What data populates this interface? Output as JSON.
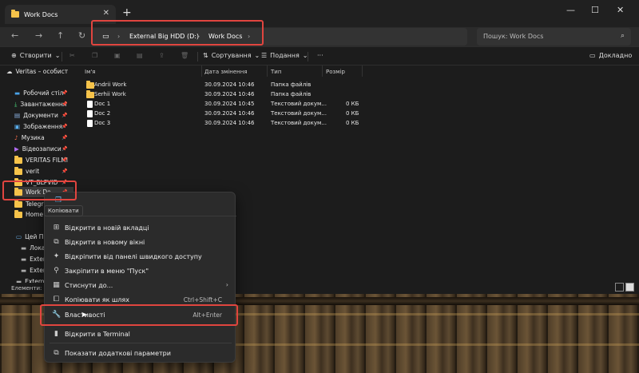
{
  "window": {
    "tab_title": "Work Docs",
    "new_tab": "+",
    "controls": [
      "—",
      "☐",
      "✕"
    ]
  },
  "nav": {
    "breadcrumbs": [
      "External Big HDD (D:)",
      "Work Docs"
    ],
    "search_placeholder": "Пошук: Work Docs"
  },
  "toolbar": {
    "create_label": "Створити",
    "sort_label": "Сортування",
    "view_label": "Подання",
    "more_label": "···",
    "details_label": "Докладно"
  },
  "sidebar": {
    "items": [
      {
        "label": "Veritas – особист",
        "icon": "cloud-icon",
        "pinned": false
      },
      {
        "label": "Робочий стіл",
        "icon": "desktop-icon",
        "pinned": true
      },
      {
        "label": "Завантаження",
        "icon": "download-icon",
        "pinned": true
      },
      {
        "label": "Документи",
        "icon": "documents-icon",
        "pinned": true
      },
      {
        "label": "Зображення",
        "icon": "pictures-icon",
        "pinned": true
      },
      {
        "label": "Музика",
        "icon": "music-icon",
        "pinned": true
      },
      {
        "label": "Відеозаписи",
        "icon": "videos-icon",
        "pinned": true
      },
      {
        "label": "VERITAS FILMI",
        "icon": "folder-icon",
        "pinned": true
      },
      {
        "label": "verit",
        "icon": "folder-icon",
        "pinned": true
      },
      {
        "label": "VT_BLPVID",
        "icon": "folder-icon",
        "pinned": true
      },
      {
        "label": "Work Do",
        "icon": "folder-icon",
        "pinned": true
      },
      {
        "label": "Telegra",
        "icon": "folder-icon",
        "pinned": false
      },
      {
        "label": "Home A",
        "icon": "folder-icon",
        "pinned": false
      },
      {
        "label": "Цей ПК",
        "icon": "pc-icon",
        "pinned": false
      },
      {
        "label": "Локал",
        "icon": "drive-icon",
        "pinned": false
      },
      {
        "label": "Extern",
        "icon": "drive-icon",
        "pinned": false
      },
      {
        "label": "Extern",
        "icon": "drive-icon",
        "pinned": false
      },
      {
        "label": "External",
        "icon": "drive-icon",
        "pinned": false
      }
    ]
  },
  "files": {
    "columns": [
      "Ім'я",
      "Дата змінення",
      "Тип",
      "Розмір"
    ],
    "rows": [
      {
        "name": "Andrii Work",
        "date": "30.09.2024 10:46",
        "type": "Папка файлів",
        "size": "",
        "kind": "folder"
      },
      {
        "name": "Serhii Work",
        "date": "30.09.2024 10:46",
        "type": "Папка файлів",
        "size": "",
        "kind": "folder"
      },
      {
        "name": "Doc 1",
        "date": "30.09.2024 10:45",
        "type": "Текстовий докум...",
        "size": "0 КБ",
        "kind": "doc"
      },
      {
        "name": "Doc 2",
        "date": "30.09.2024 10:46",
        "type": "Текстовий докум...",
        "size": "0 КБ",
        "kind": "doc"
      },
      {
        "name": "Doc 3",
        "date": "30.09.2024 10:46",
        "type": "Текстовий докум...",
        "size": "0 КБ",
        "kind": "doc"
      }
    ]
  },
  "status": {
    "items_label": "Елементи: 5"
  },
  "context_menu": {
    "tooltip": "Копіювати",
    "items": [
      {
        "label": "Відкрити в новій вкладці",
        "shortcut": "",
        "icon": "new-tab-icon"
      },
      {
        "label": "Відкрити в новому вікні",
        "shortcut": "",
        "icon": "new-window-icon"
      },
      {
        "label": "Відкріпити від панелі швидкого доступу",
        "shortcut": "",
        "icon": "unpin-icon"
      },
      {
        "label": "Закріпити в меню \"Пуск\"",
        "shortcut": "",
        "icon": "pin-icon"
      },
      {
        "label": "Стиснути до...",
        "shortcut": "",
        "icon": "zip-icon",
        "submenu": true
      },
      {
        "label": "Копіювати як шлях",
        "shortcut": "Ctrl+Shift+C",
        "icon": "copy-path-icon"
      },
      {
        "label": "Властивості",
        "shortcut": "Alt+Enter",
        "icon": "wrench-icon"
      },
      {
        "label": "Відкрити в Terminal",
        "shortcut": "",
        "icon": "terminal-icon"
      },
      {
        "label": "Показати додаткові параметри",
        "shortcut": "",
        "icon": "more-options-icon"
      }
    ]
  },
  "colors": {
    "highlight": "#e0453f",
    "folder": "#f6c34a",
    "window_bg": "#1c1c1c",
    "menu_bg": "#2b2b2b"
  }
}
